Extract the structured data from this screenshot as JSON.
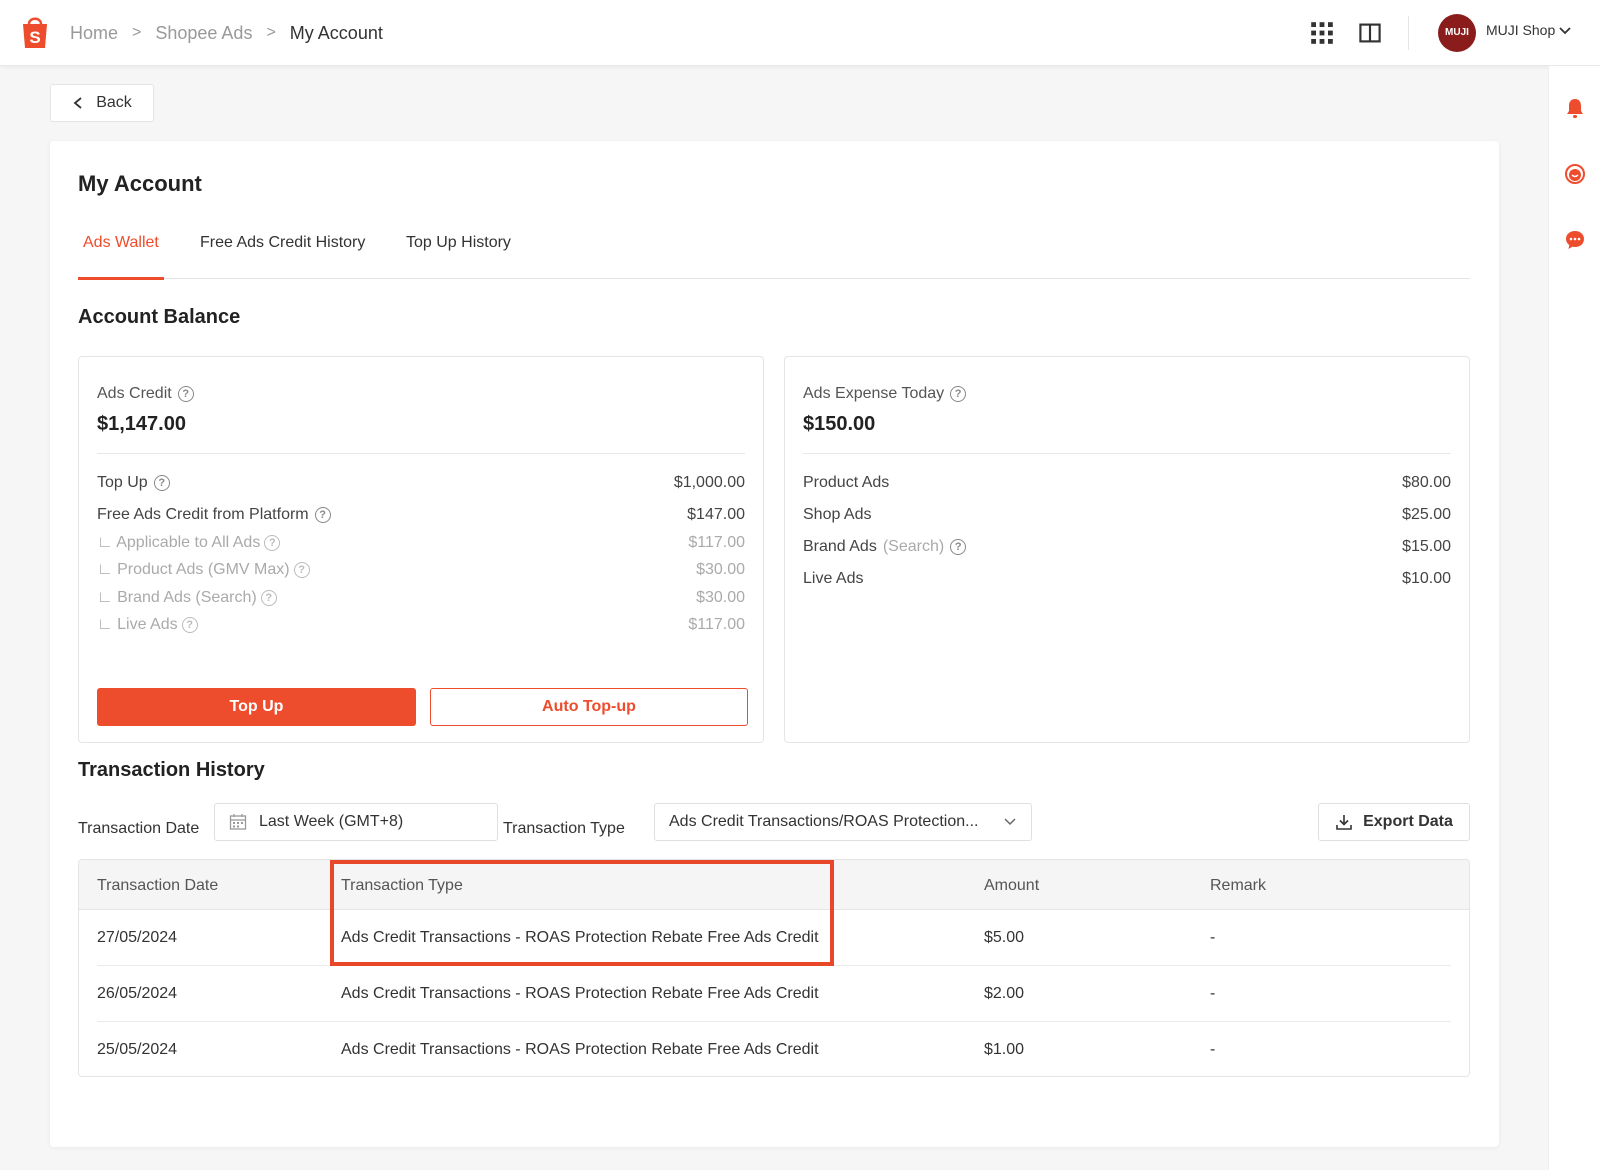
{
  "breadcrumb": {
    "home": "Home",
    "ads": "Shopee Ads",
    "current": "My Account"
  },
  "user": {
    "avatar_text": "MUJI",
    "shop_name": "MUJI Shop"
  },
  "back_label": "Back",
  "page_title": "My Account",
  "tabs": [
    {
      "label": "Ads Wallet",
      "active": true
    },
    {
      "label": "Free Ads Credit History",
      "active": false
    },
    {
      "label": "Top Up History",
      "active": false
    }
  ],
  "balance": {
    "title": "Account Balance",
    "credit": {
      "label": "Ads Credit",
      "value": "$1,147.00",
      "top_up": {
        "label": "Top Up",
        "value": "$1,000.00"
      },
      "free_credit": {
        "label": "Free Ads Credit from Platform",
        "value": "$147.00"
      },
      "sub": [
        {
          "label": "∟ Applicable to All Ads",
          "value": "$117.00"
        },
        {
          "label": "∟ Product Ads (GMV Max)",
          "value": "$30.00"
        },
        {
          "label": "∟ Brand Ads (Search)",
          "value": "$30.00"
        },
        {
          "label": "∟ Live Ads",
          "value": "$117.00"
        }
      ],
      "top_up_button": "Top Up",
      "auto_top_up_button": "Auto Top-up"
    },
    "expense": {
      "label": "Ads Expense Today",
      "value": "$150.00",
      "items": [
        {
          "label": "Product Ads",
          "suffix": "",
          "value": "$80.00"
        },
        {
          "label": "Shop Ads",
          "suffix": "",
          "value": "$25.00"
        },
        {
          "label": "Brand Ads",
          "suffix": "(Search)",
          "value": "$15.00"
        },
        {
          "label": "Live Ads",
          "suffix": "",
          "value": "$10.00"
        }
      ]
    }
  },
  "history": {
    "title": "Transaction History",
    "date_label": "Transaction Date",
    "date_value": "Last Week (GMT+8)",
    "type_label": "Transaction Type",
    "type_value": "Ads Credit Transactions/ROAS Protection...",
    "export_label": "Export Data",
    "columns": [
      "Transaction Date",
      "Transaction Type",
      "Amount",
      "Remark"
    ],
    "rows": [
      {
        "date": "27/05/2024",
        "type": "Ads Credit Transactions - ROAS Protection Rebate Free Ads Credit",
        "amount": "$5.00",
        "remark": "-"
      },
      {
        "date": "26/05/2024",
        "type": "Ads Credit Transactions - ROAS Protection Rebate Free Ads Credit",
        "amount": "$2.00",
        "remark": "-"
      },
      {
        "date": "25/05/2024",
        "type": "Ads Credit Transactions - ROAS Protection Rebate Free Ads Credit",
        "amount": "$1.00",
        "remark": "-"
      }
    ]
  },
  "colors": {
    "brand": "#ee4d2d",
    "highlight": "#e8472a"
  }
}
